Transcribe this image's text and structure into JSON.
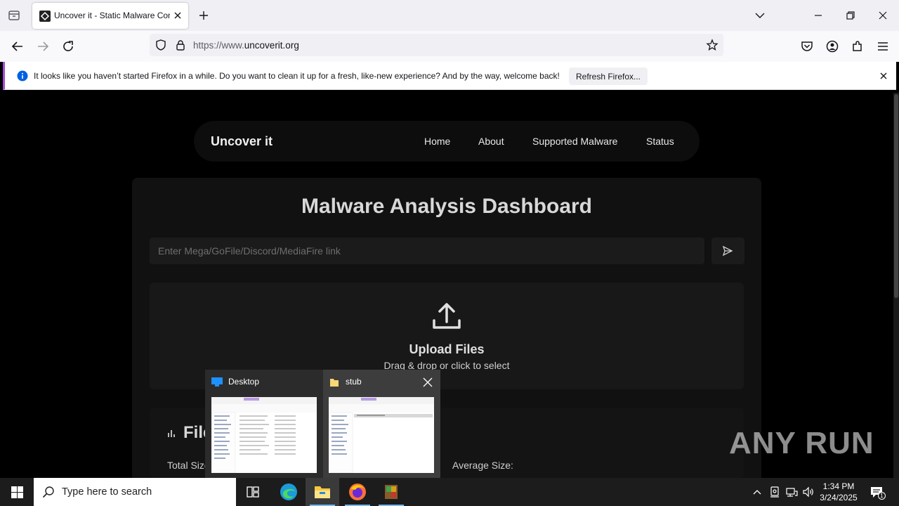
{
  "browser": {
    "tab_title": "Uncover it - Static Malware Con",
    "url_prefix": "https://www.",
    "url_domain": "uncoverit.org",
    "notification": "It looks like you haven’t started Firefox in a while. Do you want to clean it up for a fresh, like-new experience? And by the way, welcome back!",
    "refresh_label": "Refresh Firefox..."
  },
  "site": {
    "brand": "Uncover it",
    "nav": [
      "Home",
      "About",
      "Supported Malware",
      "Status"
    ],
    "dashboard_title": "Malware Analysis Dashboard",
    "link_placeholder": "Enter Mega/GoFile/Discord/MediaFire link",
    "upload_title": "Upload Files",
    "upload_subtitle": "Drag & drop or click to select",
    "stats_title": "File",
    "total_size_label": "Total Size",
    "average_size_label": "Average Size:"
  },
  "taskbar_preview": {
    "items": [
      "Desktop",
      "stub"
    ]
  },
  "watermark": "ANY RUN",
  "taskbar": {
    "search_placeholder": "Type here to search",
    "time": "1:34 PM",
    "date": "3/24/2025",
    "notification_count": "1"
  },
  "colors": {
    "notification_accent": "#a54cd4",
    "info_icon": "#0061e0",
    "taskbar_active_underline": "#76b9ed"
  }
}
